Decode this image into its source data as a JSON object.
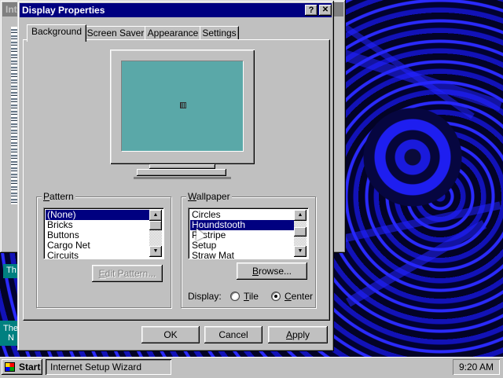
{
  "background_window": {
    "title_fragment": "Int",
    "teal_label_1": "Th",
    "teal_label_2a": "The",
    "teal_label_2b": "N"
  },
  "dialog": {
    "title": "Display Properties",
    "help_button": "?",
    "close_button": "✕",
    "tabs": [
      {
        "label": "Background",
        "active": true
      },
      {
        "label": "Screen Saver",
        "active": false
      },
      {
        "label": "Appearance",
        "active": false
      },
      {
        "label": "Settings",
        "active": false
      }
    ],
    "pattern": {
      "label_u": "P",
      "label_rest": "attern",
      "items": [
        "(None)",
        "Bricks",
        "Buttons",
        "Cargo Net",
        "Circuits"
      ],
      "selected": "(None)",
      "edit_button": {
        "label_u": "E",
        "label_rest": "dit Pattern...",
        "enabled": false
      }
    },
    "wallpaper": {
      "label_u": "W",
      "label_rest": "allpaper",
      "items": [
        "Circles",
        "Houndstooth",
        "Pinstripe",
        "Setup",
        "Straw Mat"
      ],
      "items_display": [
        "Circles",
        "Houndstooth",
        "Pi stripe",
        "Setup",
        "Straw Mat"
      ],
      "selected": "Houndstooth",
      "browse_button": {
        "label_u": "B",
        "label_rest": "rowse..."
      },
      "display_label": "Display:",
      "tile_label_u": "T",
      "tile_label_rest": "ile",
      "center_label_u": "C",
      "center_label_rest": "enter",
      "display_mode": "Center"
    },
    "buttons": {
      "ok": "OK",
      "cancel": "Cancel",
      "apply_u": "A",
      "apply_rest": "pply"
    }
  },
  "taskbar": {
    "start_label": "Start",
    "task_item": "Internet Setup Wizard",
    "clock": "9:20 AM"
  },
  "colors": {
    "title_bar": "#000080",
    "face": "#c0c0c0",
    "monitor_screen": "#5aa8a8",
    "desktop_accent": "#1a1adc"
  }
}
